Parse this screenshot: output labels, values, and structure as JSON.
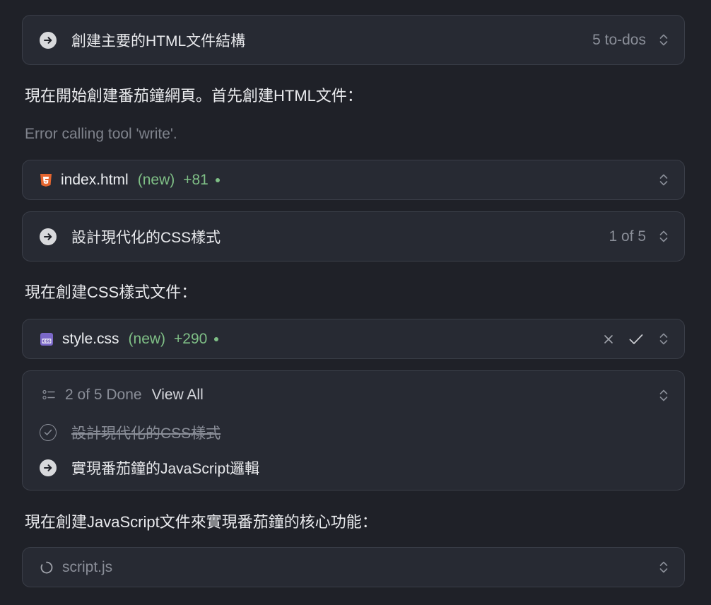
{
  "task1": {
    "label": "創建主要的HTML文件結構",
    "count": "5 to-dos",
    "icon": "arrow-right-circle-icon"
  },
  "para1": "現在開始創建番茄鐘網頁。首先創建HTML文件：",
  "error_text": "Error calling tool 'write'.",
  "file1": {
    "name": "index.html",
    "tag": "(new)",
    "added": "+81",
    "icon": "html5-icon"
  },
  "task2": {
    "label": "設計現代化的CSS樣式",
    "count": "1 of 5",
    "icon": "arrow-right-circle-icon"
  },
  "para2": "現在創建CSS樣式文件：",
  "file2": {
    "name": "style.css",
    "tag": "(new)",
    "added": "+290",
    "icon": "css-file-icon"
  },
  "todos": {
    "summary": "2 of 5 Done",
    "view_all": "View All",
    "items": [
      {
        "label": "設計現代化的CSS樣式",
        "done": true
      },
      {
        "label": "實現番茄鐘的JavaScript邏輯",
        "done": false
      }
    ]
  },
  "para3": "現在創建JavaScript文件來實現番茄鐘的核心功能：",
  "file3": {
    "name": "script.js",
    "status": "loading"
  },
  "colors": {
    "bg": "#1f2128",
    "card": "#272a33",
    "border": "#3a3e48",
    "green": "#7fbf86",
    "html_orange": "#e4652f",
    "css_purple": "#7b68c8"
  }
}
